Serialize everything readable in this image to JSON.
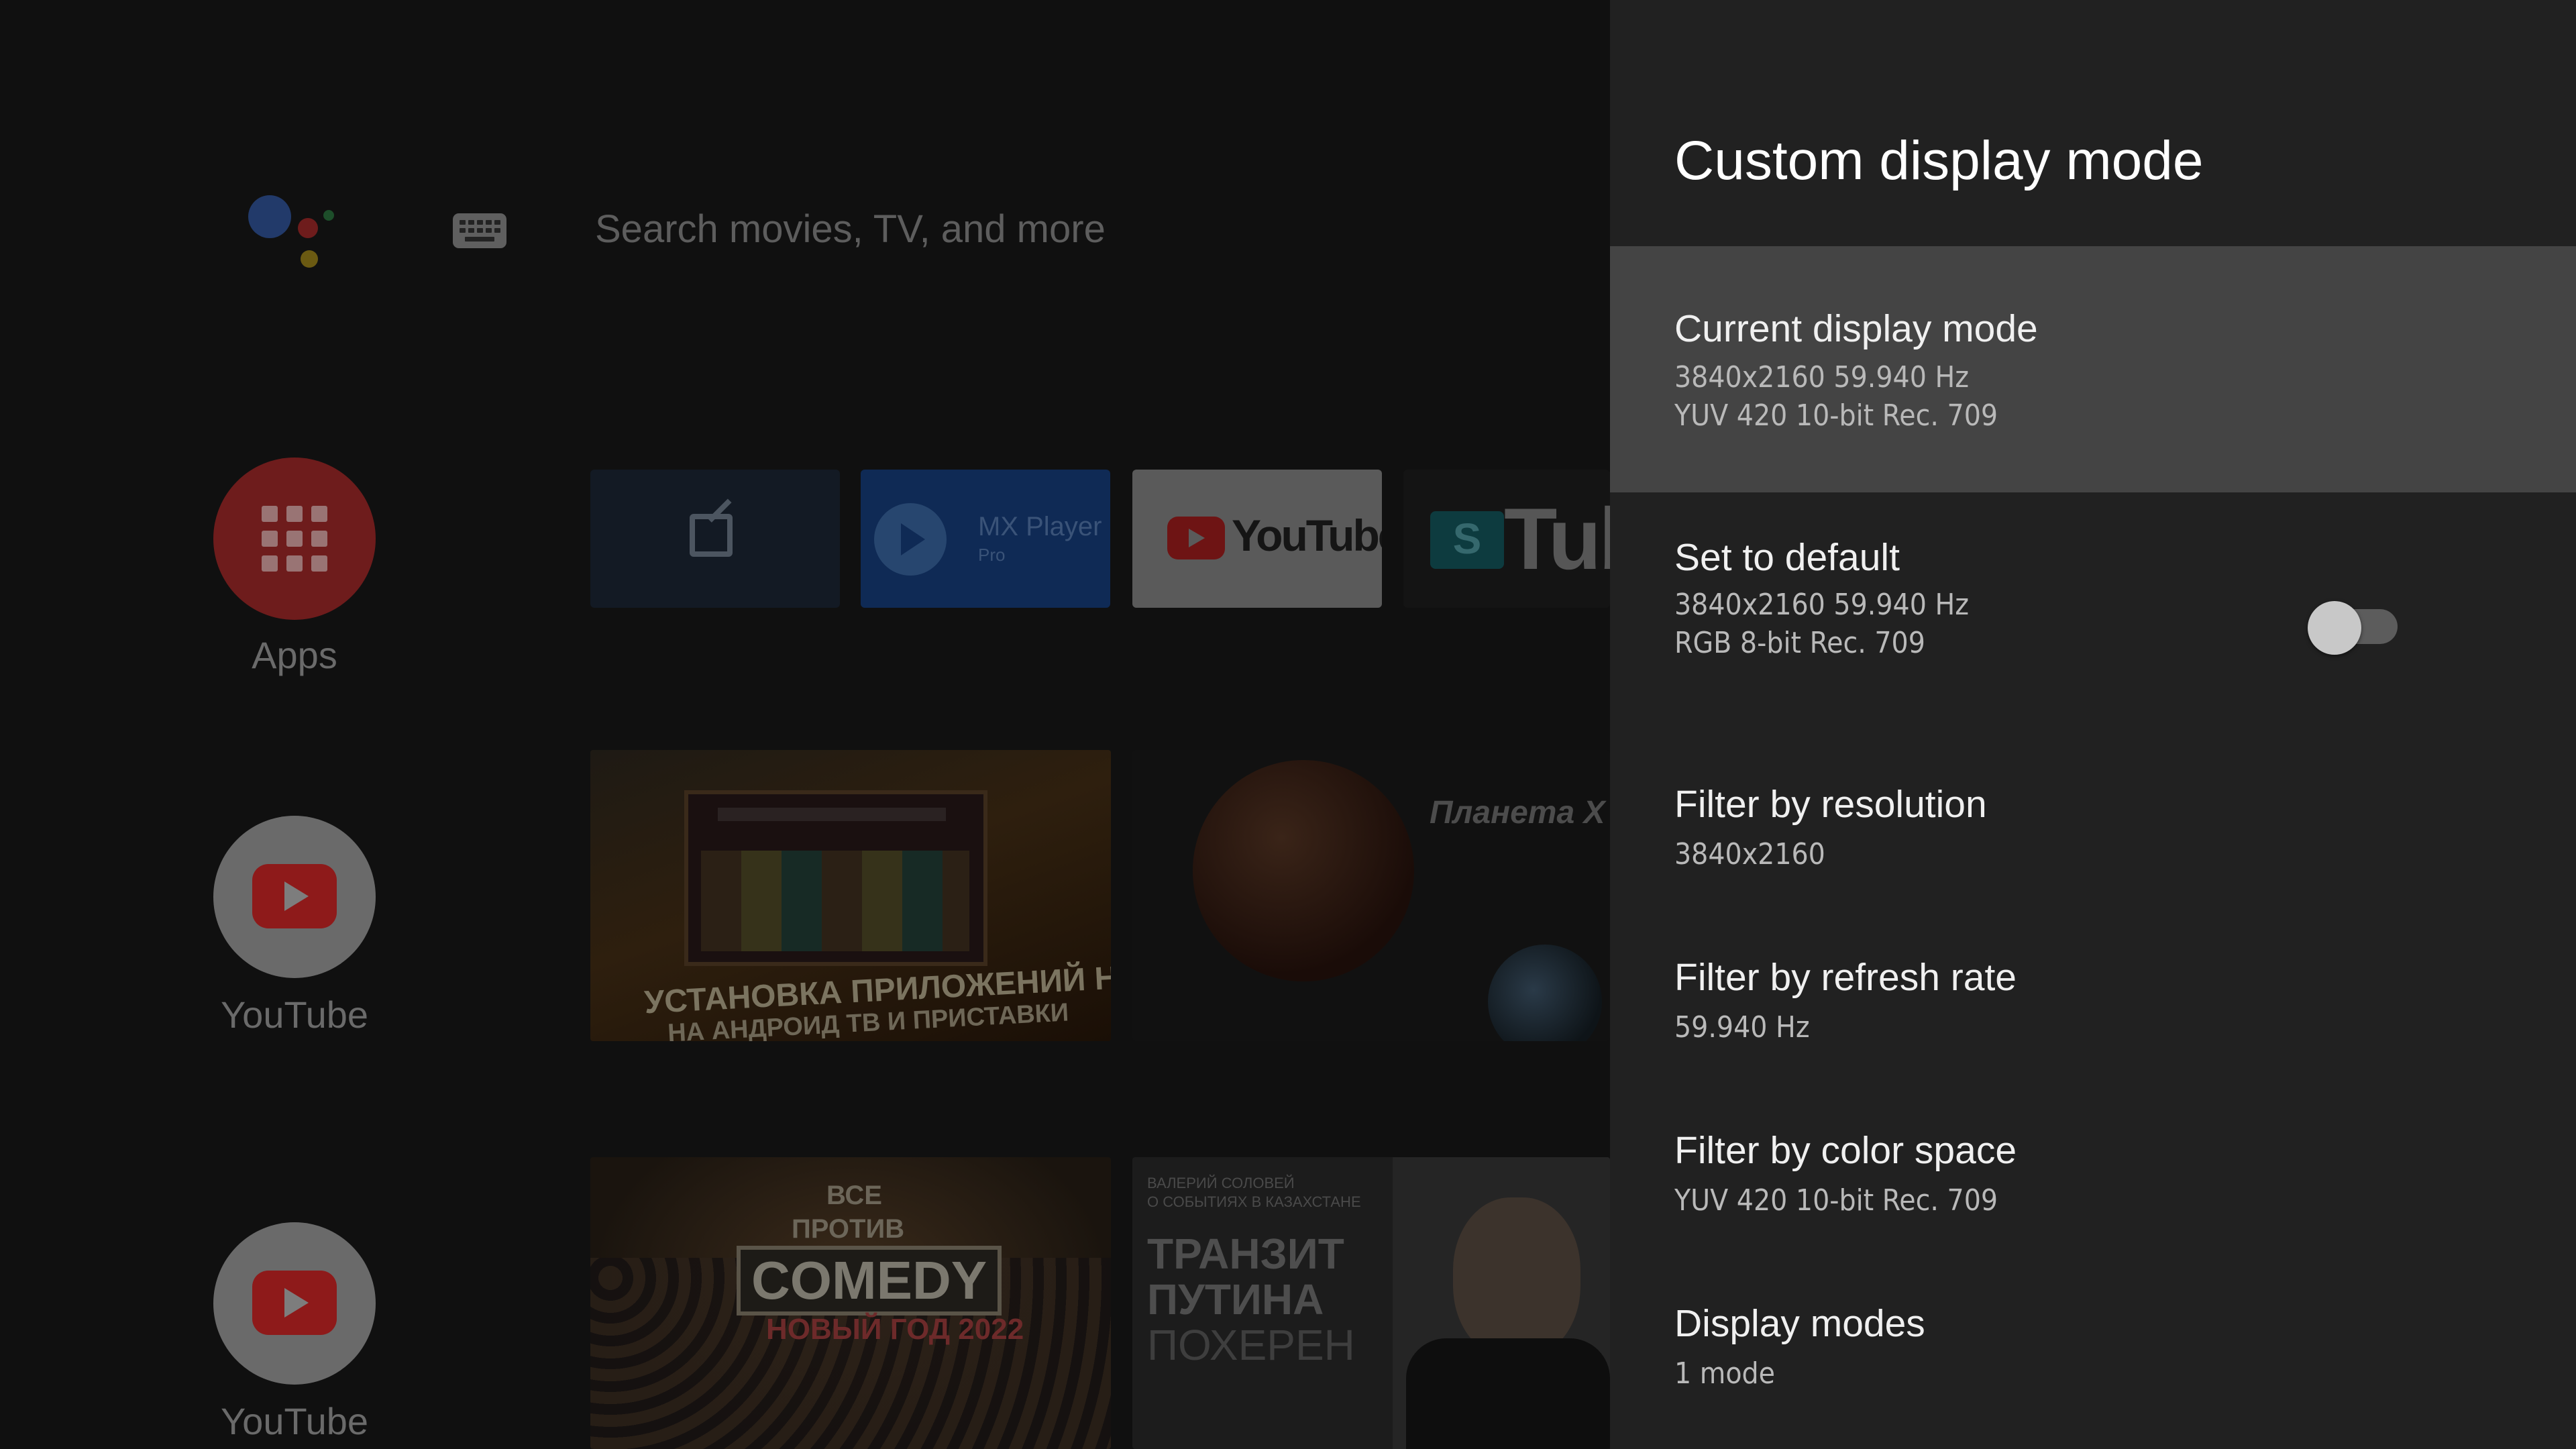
{
  "home": {
    "search_placeholder": "Search movies, TV, and more",
    "icons": {
      "assistant": "google-assistant-icon",
      "keyboard": "keyboard-icon"
    },
    "side": [
      {
        "label": "Apps",
        "icon": "apps-grid-icon"
      },
      {
        "label": "YouTube",
        "icon": "youtube-icon"
      },
      {
        "label": "YouTube",
        "icon": "youtube-icon"
      }
    ],
    "channels": [
      {
        "icon": "external-link-icon"
      },
      {
        "title": "MX Player",
        "subtitle": "Pro"
      },
      {
        "title": "YouTube"
      },
      {
        "title": "Tube",
        "badge": "S"
      }
    ],
    "videos": {
      "v1": {
        "line1": "УСТАНОВКА ПРИЛОЖЕНИЙ НА",
        "line2": "НА АНДРОИД ТВ И ПРИСТАВКИ"
      },
      "v2": {
        "title": "Планета Х"
      },
      "v3": {
        "top1": "ВСЕ",
        "top2": "ПРОТИВ",
        "main": "COMEDY",
        "year": "НОВЫЙ ГОД 2022"
      },
      "v4": {
        "small1": "ВАЛЕРИЙ СОЛОВЕЙ",
        "small2": "О СОБЫТИЯХ В КАЗАХСТАНЕ",
        "big1": "ТРАНЗИТ",
        "big2": "ПУТИНА",
        "big3": "ПОХЕРЕН"
      }
    },
    "colors": {
      "assistant_blue": "#223a6a",
      "assistant_red": "#6e1c1c",
      "assistant_yellow": "#6b5a12",
      "assistant_green": "#1d4e2a"
    }
  },
  "panel": {
    "title": "Custom display mode",
    "rows": [
      {
        "title": "Current display mode",
        "lines": [
          "3840x2160 59.940 Hz",
          "YUV 420 10-bit Rec. 709"
        ],
        "focused": true
      },
      {
        "title": "Set to default",
        "lines": [
          "3840x2160 59.940 Hz",
          "RGB 8-bit Rec. 709"
        ],
        "toggle": false
      },
      {
        "title": "Filter by resolution",
        "lines": [
          "3840x2160"
        ]
      },
      {
        "title": "Filter by refresh rate",
        "lines": [
          "59.940 Hz"
        ]
      },
      {
        "title": "Filter by color space",
        "lines": [
          "YUV 420 10-bit Rec. 709"
        ]
      },
      {
        "title": "Display modes",
        "lines": [
          "1 mode"
        ]
      }
    ],
    "colors": {
      "panel_bg": "#212121",
      "focus_bg": "#444444",
      "title": "#ffffff",
      "subtitle": "#b9b9b9"
    }
  }
}
